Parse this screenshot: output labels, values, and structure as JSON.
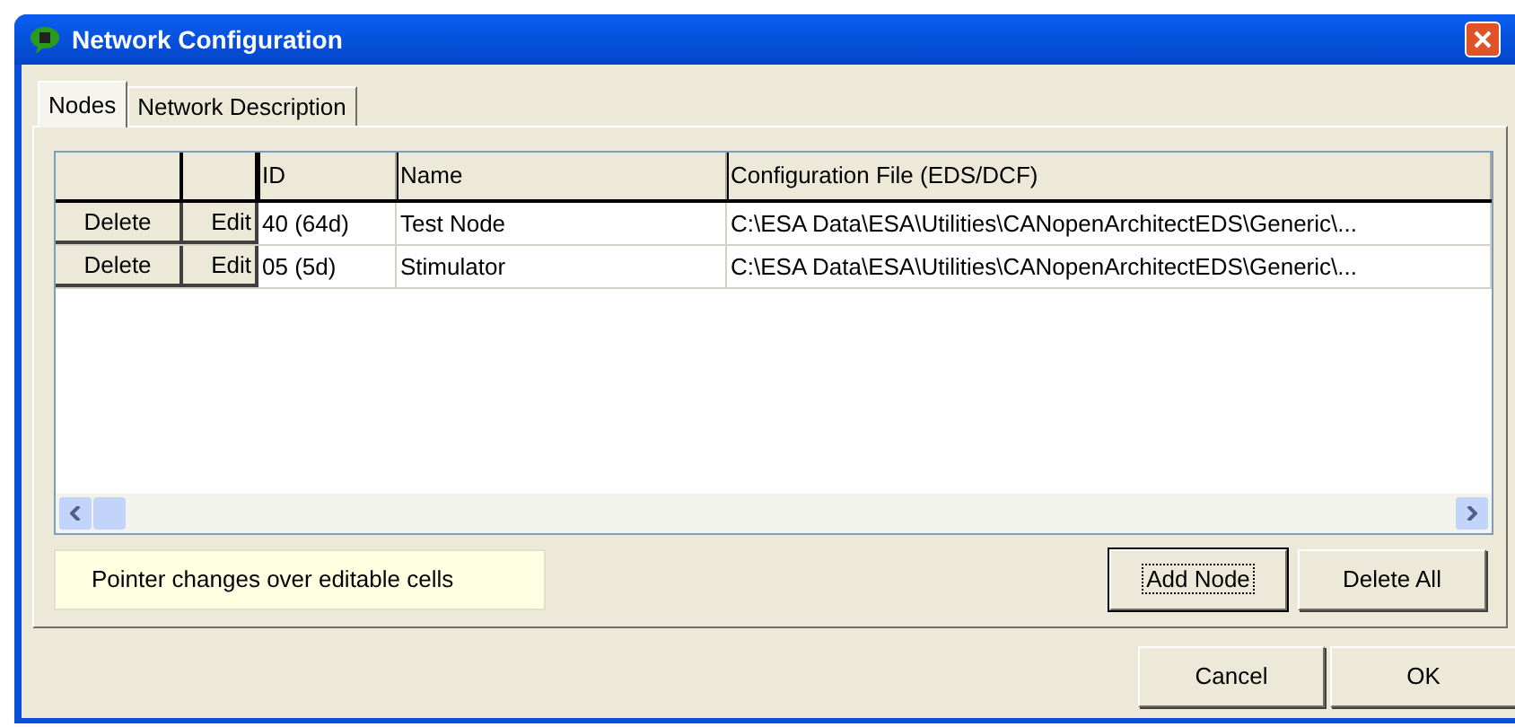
{
  "window": {
    "title": "Network Configuration"
  },
  "tabs": [
    {
      "label": "Nodes",
      "selected": true
    },
    {
      "label": "Network Description",
      "selected": false
    }
  ],
  "table": {
    "columns": [
      "ID",
      "Name",
      "Configuration File (EDS/DCF)"
    ],
    "rows": [
      {
        "delete": "Delete",
        "edit": "Edit",
        "cells": [
          "40 (64d)",
          "Test Node",
          "C:\\ESA Data\\ESA\\Utilities\\CANopenArchitectEDS\\Generic\\..."
        ]
      },
      {
        "delete": "Delete",
        "edit": "Edit",
        "cells": [
          "05 (5d)",
          "Stimulator",
          "C:\\ESA Data\\ESA\\Utilities\\CANopenArchitectEDS\\Generic\\..."
        ]
      }
    ]
  },
  "hint": "Pointer changes over editable cells",
  "panel_buttons": [
    {
      "label": "Add Node",
      "selected": true
    },
    {
      "label": "Delete All",
      "selected": false
    }
  ],
  "dialog_buttons": [
    "Cancel",
    "OK"
  ]
}
